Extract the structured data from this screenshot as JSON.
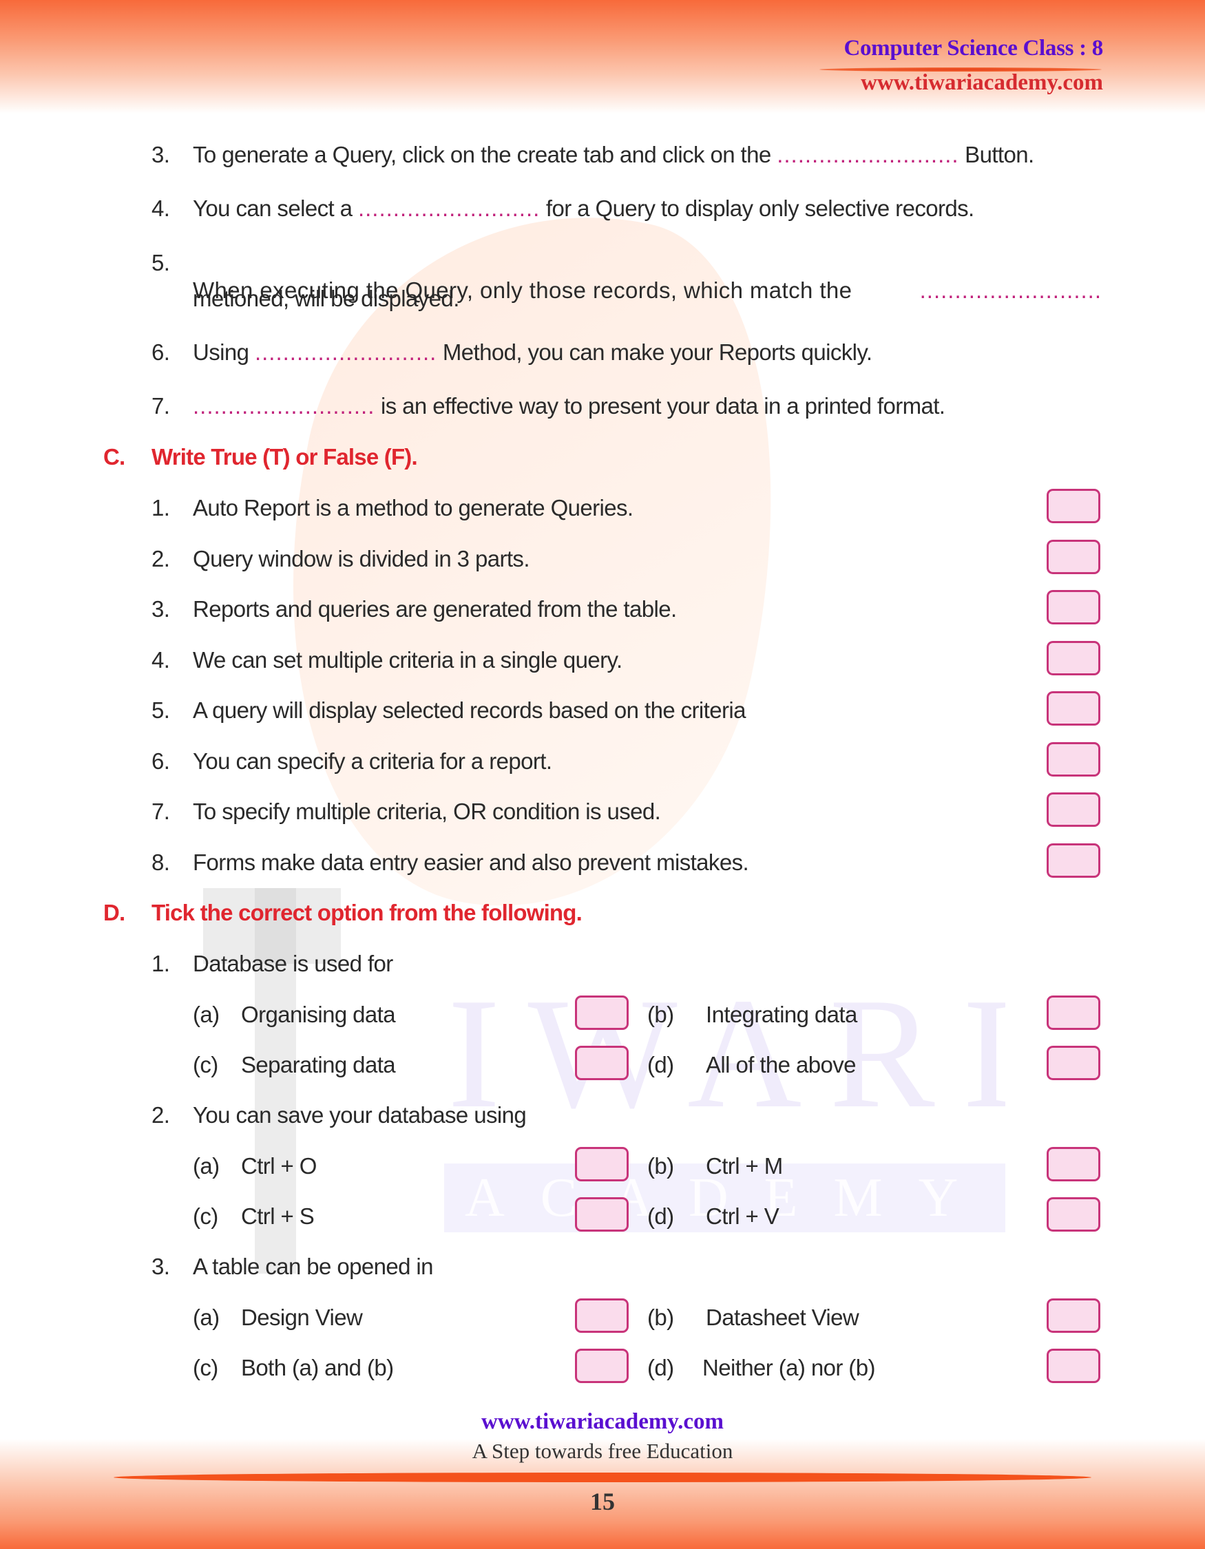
{
  "header": {
    "title": "Computer Science Class : 8",
    "url": "www.tiwariacademy.com"
  },
  "watermark": {
    "word1": "IWARI",
    "word2": "ACADEMY"
  },
  "blank": "..........................",
  "fill_blanks": [
    {
      "num": "3.",
      "before": "To generate a Query, click on the create tab and click on the ",
      "after": " Button."
    },
    {
      "num": "4.",
      "before": "You can select a ",
      "after": " for a Query to display only selective records."
    },
    {
      "num": "5.",
      "before": "When executing the Query, only those records, which match the ",
      "after": "",
      "continuation": "metioned, will be displayed."
    },
    {
      "num": "6.",
      "before": "Using ",
      "after": " Method, you can make your Reports quickly."
    },
    {
      "num": "7.",
      "before": "",
      "after": " is an effective way to present your data in a printed format."
    }
  ],
  "section_c": {
    "letter": "C.",
    "title": "Write True (T) or False (F).",
    "items": [
      {
        "num": "1.",
        "text": "Auto Report is a method to generate Queries."
      },
      {
        "num": "2.",
        "text": "Query window is divided in 3 parts."
      },
      {
        "num": "3.",
        "text": "Reports and queries are generated from the table."
      },
      {
        "num": "4.",
        "text": "We can set multiple criteria in a single query."
      },
      {
        "num": "5.",
        "text": "A query will display selected records based on the criteria"
      },
      {
        "num": "6.",
        "text": "You can specify a criteria for a report."
      },
      {
        "num": "7.",
        "text": "To specify multiple criteria, OR condition is used."
      },
      {
        "num": "8.",
        "text": "Forms make data entry easier and also prevent mistakes."
      }
    ]
  },
  "section_d": {
    "letter": "D.",
    "title": "Tick the correct option from the following.",
    "questions": [
      {
        "num": "1.",
        "text": "Database is used for",
        "options": [
          {
            "label": "(a)",
            "text": "Organising data"
          },
          {
            "label": "(b)",
            "text": "Integrating data"
          },
          {
            "label": "(c)",
            "text": "Separating data"
          },
          {
            "label": "(d)",
            "text": "All of the above"
          }
        ]
      },
      {
        "num": "2.",
        "text": "You can save your database using",
        "options": [
          {
            "label": "(a)",
            "text": "Ctrl + O"
          },
          {
            "label": "(b)",
            "text": "Ctrl + M"
          },
          {
            "label": "(c)",
            "text": "Ctrl + S"
          },
          {
            "label": "(d)",
            "text": "Ctrl + V"
          }
        ]
      },
      {
        "num": "3.",
        "text": "A table can be opened in",
        "options": [
          {
            "label": "(a)",
            "text": "Design View"
          },
          {
            "label": "(b)",
            "text": "Datasheet View"
          },
          {
            "label": "(c)",
            "text": "Both (a) and (b)"
          },
          {
            "label": "(d)",
            "text": "Neither (a) nor (b)"
          }
        ]
      }
    ]
  },
  "footer": {
    "url": "www.tiwariacademy.com",
    "tagline": "A Step towards free Education",
    "page_number": "15"
  }
}
